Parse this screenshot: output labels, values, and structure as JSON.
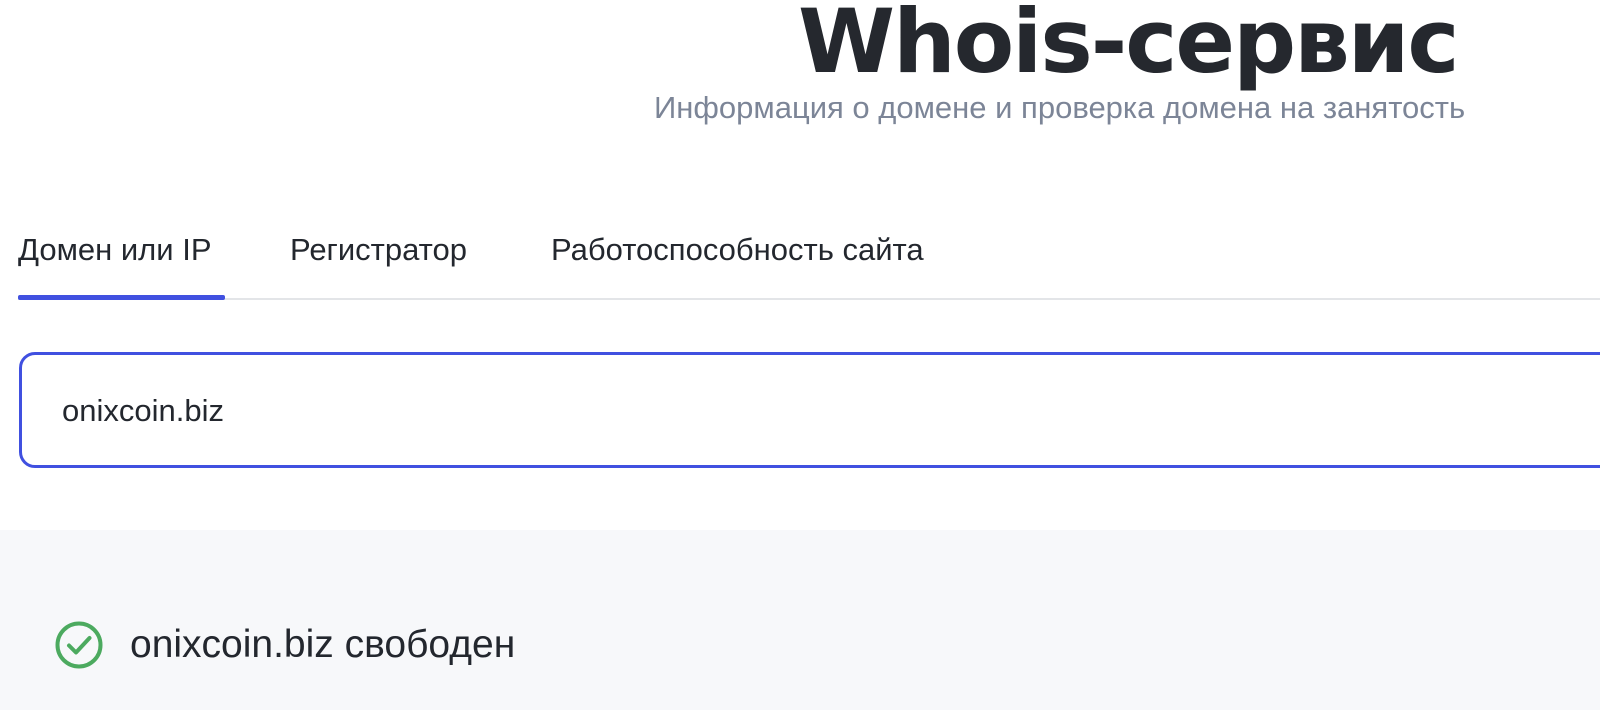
{
  "header": {
    "title": "Whois-сервис",
    "subtitle": "Информация о домене и проверка домена на занятость"
  },
  "tabs": [
    {
      "label": "Домен или IP",
      "active": true
    },
    {
      "label": "Регистратор",
      "active": false
    },
    {
      "label": "Работоспособность сайта",
      "active": false
    }
  ],
  "search": {
    "value": "onixcoin.biz",
    "placeholder": ""
  },
  "result": {
    "icon": "check-circle-icon",
    "text": "onixcoin.biz свободен",
    "status_color": "#4caa5f"
  },
  "colors": {
    "accent": "#4050e0",
    "title": "#25282e",
    "subtitle": "#7c8597",
    "panel_background": "#f7f8fa"
  }
}
